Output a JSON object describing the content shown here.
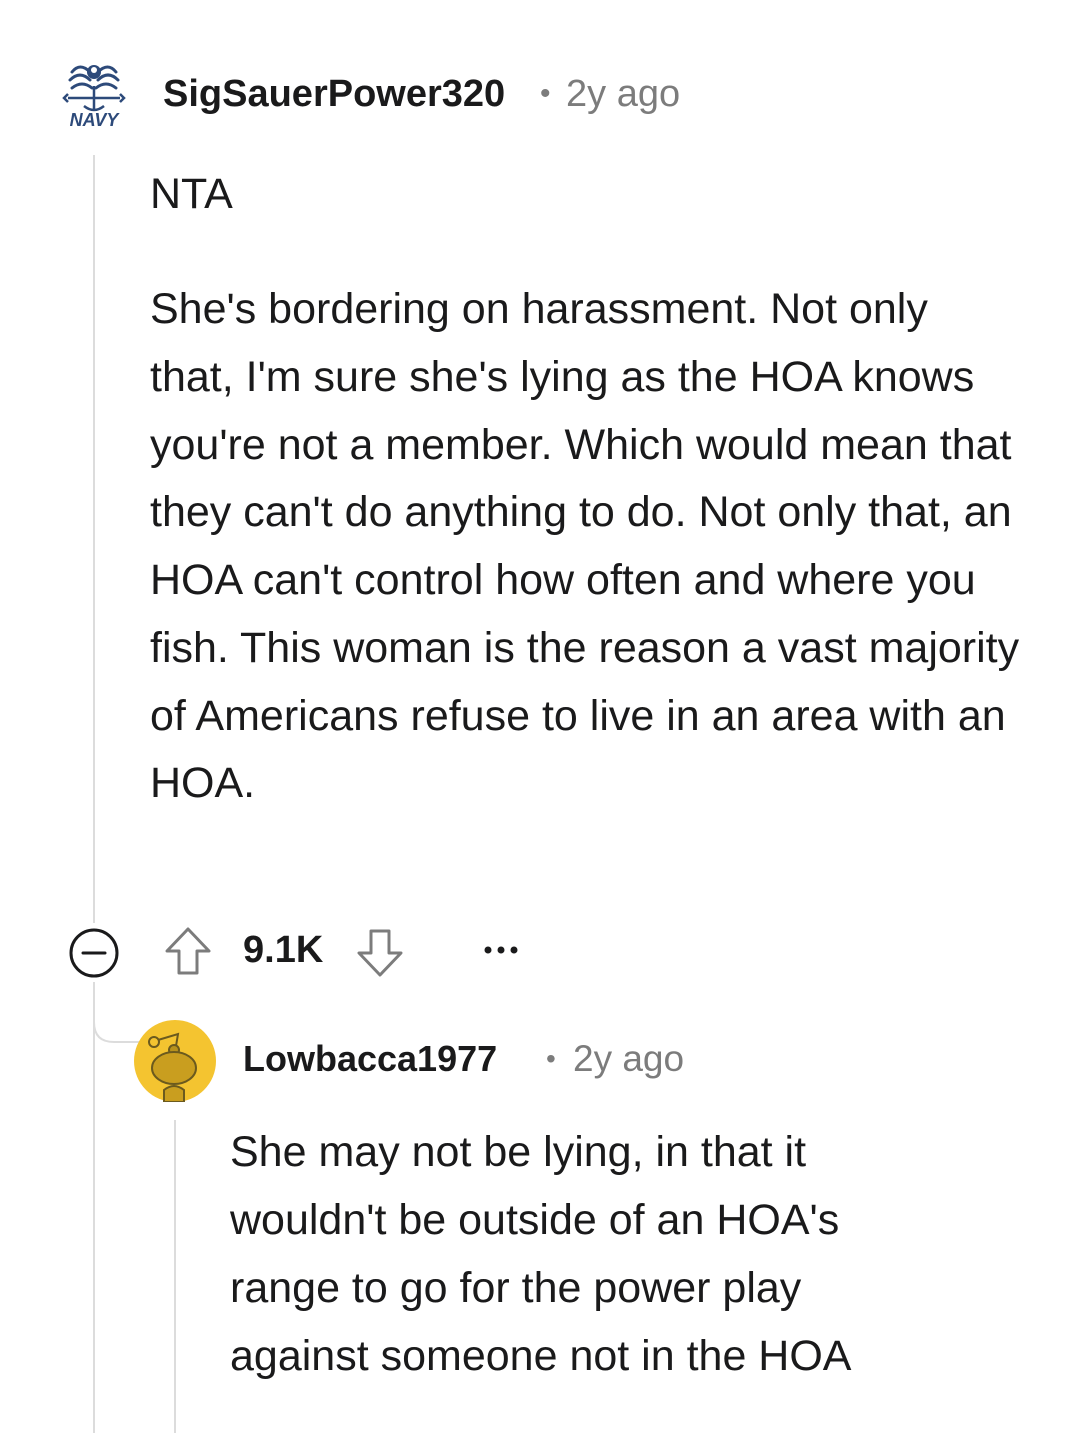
{
  "comment": {
    "username": "SigSauerPower320",
    "separator": "•",
    "timestamp": "2y ago",
    "avatar_icon": "navy-emblem-icon",
    "avatar_text": "NAVY",
    "paragraphs": [
      "NTA",
      "She's bordering on harassment. Not only that, I'm sure she's lying as the HOA knows you're not a member. Which would mean that they can't do anything to do. Not only that, an HOA can't control how often and where you fish. This woman is the reason a vast majority of Americans refuse to live in an area with an HOA."
    ],
    "score": "9.1K",
    "actions": {
      "collapse_icon": "minus-circle-icon",
      "upvote_icon": "arrow-up-icon",
      "downvote_icon": "arrow-down-icon",
      "more_icon": "ellipsis-icon"
    }
  },
  "reply": {
    "username": "Lowbacca1977",
    "separator": "•",
    "timestamp": "2y ago",
    "avatar_icon": "snoo-avatar-icon",
    "avatar_color": "#f4c430",
    "body": "She may not be lying, in that it wouldn't be outside of an HOA's range to go for the power play against someone not in the HOA"
  },
  "colors": {
    "text": "#1a1a1b",
    "meta": "#7c7c7c",
    "thread_line": "#dcdcdc",
    "navy_blue": "#2d4a7a"
  }
}
